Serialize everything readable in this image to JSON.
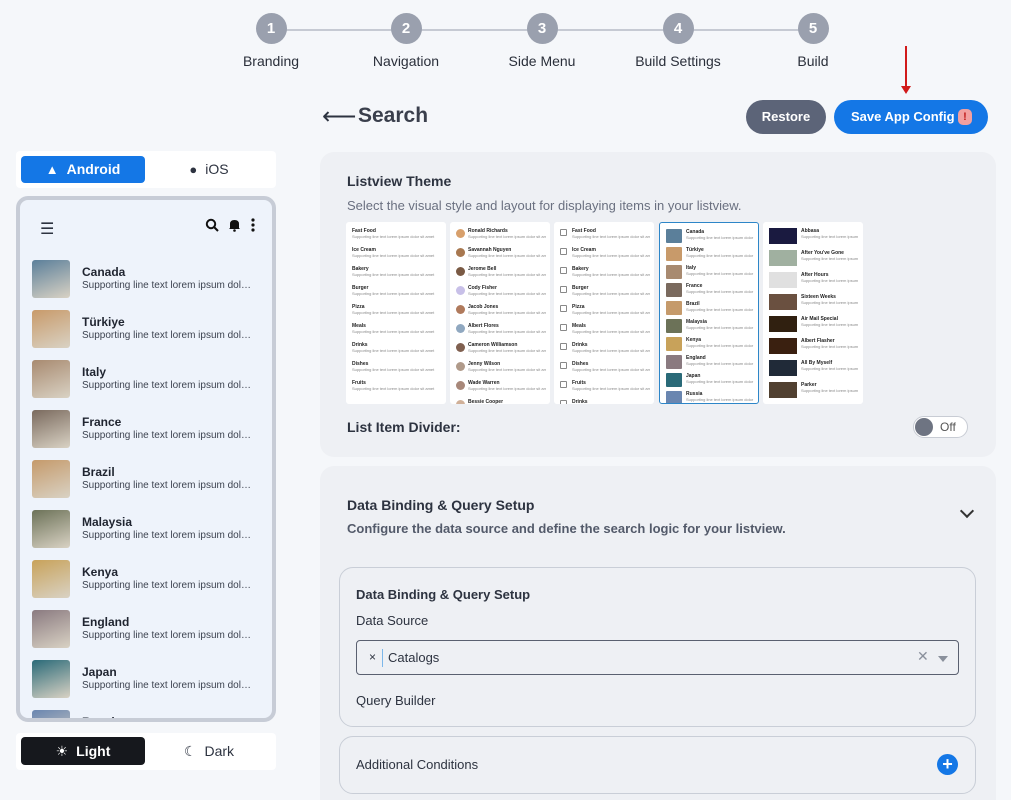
{
  "stepper": {
    "steps": [
      {
        "num": "1",
        "label": "Branding"
      },
      {
        "num": "2",
        "label": "Navigation"
      },
      {
        "num": "3",
        "label": "Side Menu"
      },
      {
        "num": "4",
        "label": "Build Settings"
      },
      {
        "num": "5",
        "label": "Build"
      }
    ]
  },
  "header": {
    "title": "Search",
    "restore_label": "Restore",
    "save_label": "Save App Config",
    "save_badge": "!"
  },
  "preview": {
    "os": {
      "android": "Android",
      "ios": "iOS",
      "selected": "Android"
    },
    "theme": {
      "light": "Light",
      "dark": "Dark",
      "selected": "Light"
    },
    "items": [
      {
        "title": "Canada",
        "subtitle": "Supporting line text lorem ipsum dolor sit amet",
        "color": "#5b7f9a"
      },
      {
        "title": "Türkiye",
        "subtitle": "Supporting line text lorem ipsum dolor sit amet",
        "color": "#c89a6a"
      },
      {
        "title": "Italy",
        "subtitle": "Supporting line text lorem ipsum dolor sit amet",
        "color": "#a88a70"
      },
      {
        "title": "France",
        "subtitle": "Supporting line text lorem ipsum dolor sit amet",
        "color": "#7a6a5e"
      },
      {
        "title": "Brazil",
        "subtitle": "Supporting line text lorem ipsum dolor sit amet",
        "color": "#c59a6b"
      },
      {
        "title": "Malaysia",
        "subtitle": "Supporting line text lorem ipsum dolor sit amet",
        "color": "#6c7258"
      },
      {
        "title": "Kenya",
        "subtitle": "Supporting line text lorem ipsum dolor sit amet",
        "color": "#c8a25a"
      },
      {
        "title": "England",
        "subtitle": "Supporting line text lorem ipsum dolor sit amet",
        "color": "#8a7a80"
      },
      {
        "title": "Japan",
        "subtitle": "Supporting line text lorem ipsum dolor sit amet",
        "color": "#2a6a78"
      },
      {
        "title": "Russia",
        "subtitle": "Supporting line text lorem ipsum dolor sit amet",
        "color": "#6a86b0"
      }
    ]
  },
  "listview_theme": {
    "heading": "Listview Theme",
    "description": "Select the visual style and layout for displaying items in your listview.",
    "divider_label": "List Item Divider:",
    "divider_state": "Off",
    "selected_index": 3,
    "options": [
      {
        "style": "text",
        "rows": [
          "Fast Food",
          "Ice Cream",
          "Bakery",
          "Burger",
          "Pizza",
          "Meals",
          "Drinks",
          "Dishes",
          "Fruits"
        ]
      },
      {
        "style": "avatar",
        "rows": [
          "Ronald Richards",
          "Savannah Nguyen",
          "Jerome Bell",
          "Cody Fisher",
          "Jacob Jones",
          "Albert Flores",
          "Cameron Williamson",
          "Jenny Wilson",
          "Wade Warren",
          "Bessie Cooper"
        ]
      },
      {
        "style": "icon",
        "rows": [
          "Fast Food",
          "Ice Cream",
          "Bakery",
          "Burger",
          "Pizza",
          "Meals",
          "Drinks",
          "Dishes",
          "Fruits",
          "Drinks"
        ]
      },
      {
        "style": "image",
        "rows": [
          "Canada",
          "Türkiye",
          "Italy",
          "France",
          "Brazil",
          "Malaysia",
          "Kenya",
          "England",
          "Japan",
          "Russia"
        ]
      },
      {
        "style": "wide",
        "rows": [
          "Abbasa",
          "After You've Gone",
          "After Hours",
          "Sixteen Weeks",
          "Air Mail Special",
          "Albert Flasher",
          "All By Myself",
          "Parker"
        ]
      }
    ],
    "row_subtitle": "Supporting line text lorem ipsum dolor sit amet"
  },
  "data_binding": {
    "heading": "Data Binding & Query Setup",
    "description": "Configure the data source and define the search logic for your listview.",
    "inner_heading": "Data Binding & Query Setup",
    "data_source_label": "Data Source",
    "data_source_value": "Catalogs",
    "query_builder_label": "Query Builder",
    "additional_conditions_label": "Additional Conditions"
  }
}
